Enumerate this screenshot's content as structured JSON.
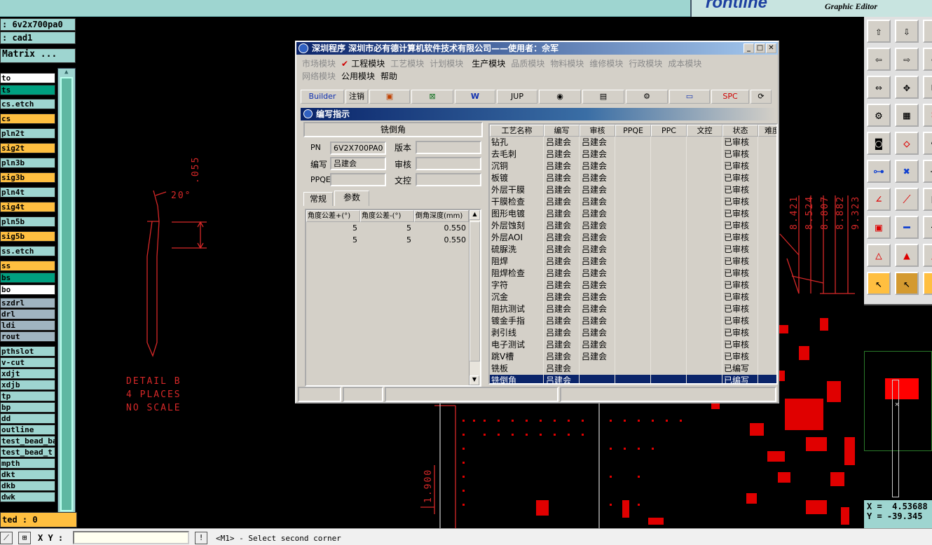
{
  "top": {
    "logo": "rontline",
    "subtitle": "Graphic Editor"
  },
  "info": {
    "job": ": 6v2x700pa0",
    "step": ": cad1",
    "matrix": "Matrix ..."
  },
  "layers": [
    {
      "name": "to",
      "color": "#ffffff"
    },
    {
      "name": "ts",
      "color": "#00a080"
    },
    {
      "name": "cs.etch",
      "color": "#9ed5d0"
    },
    {
      "name": "cs",
      "color": "#ffbf40"
    },
    {
      "name": "pln2t",
      "color": "#9ed5d0"
    },
    {
      "name": "sig2t",
      "color": "#ffbf40"
    },
    {
      "name": "pln3b",
      "color": "#9ed5d0"
    },
    {
      "name": "sig3b",
      "color": "#ffbf40"
    },
    {
      "name": "pln4t",
      "color": "#9ed5d0"
    },
    {
      "name": "sig4t",
      "color": "#ffbf40"
    },
    {
      "name": "pln5b",
      "color": "#9ed5d0"
    },
    {
      "name": "sig5b",
      "color": "#ffbf40"
    },
    {
      "name": "ss.etch",
      "color": "#9ed5d0"
    },
    {
      "name": "ss",
      "color": "#ffbf40"
    },
    {
      "name": "bs",
      "color": "#00a080"
    },
    {
      "name": "bo",
      "color": "#ffffff"
    },
    {
      "name": "szdrl",
      "color": "#a0b4c0"
    },
    {
      "name": "drl",
      "color": "#a0b4c0"
    },
    {
      "name": "ldi",
      "color": "#a0b4c0"
    },
    {
      "name": "rout",
      "color": "#a0b4c0"
    },
    {
      "name": "pthslot",
      "color": "#9ed5d0"
    },
    {
      "name": "v-cut",
      "color": "#9ed5d0"
    },
    {
      "name": "xdjt",
      "color": "#9ed5d0"
    },
    {
      "name": "xdjb",
      "color": "#9ed5d0"
    },
    {
      "name": "tp",
      "color": "#9ed5d0"
    },
    {
      "name": "bp",
      "color": "#9ed5d0"
    },
    {
      "name": "dd",
      "color": "#9ed5d0"
    },
    {
      "name": "outline",
      "color": "#9ed5d0"
    },
    {
      "name": "test_bead_ba",
      "color": "#9ed5d0"
    },
    {
      "name": "test_bead_t",
      "color": "#9ed5d0"
    },
    {
      "name": "mpth",
      "color": "#9ed5d0"
    },
    {
      "name": "dkt",
      "color": "#9ed5d0"
    },
    {
      "name": "dkb",
      "color": "#9ed5d0"
    },
    {
      "name": "dwk",
      "color": "#9ed5d0"
    }
  ],
  "bottom": {
    "selected": "ted : 0",
    "xy_label": "X Y :",
    "xy_value": "",
    "prompt": "<M1> - Select second corner"
  },
  "coords": {
    "x": "X =  4.53688",
    "y": "Y = -39.345"
  },
  "canvas": {
    "angle": "20°",
    "dim_top": ".055",
    "detail": "DETAIL B",
    "places": "4 PLACES",
    "scale": "NO SCALE",
    "dim_bottom": "1.900",
    "right_dims": [
      "8.421",
      "8.524",
      "8.807",
      "8.882",
      "9.323"
    ]
  },
  "dialog": {
    "title": "深圳程序    深圳市必有德计算机软件技术有限公司——使用者：佘军",
    "menu_row1": [
      {
        "label": "市场模块",
        "enabled": false
      },
      {
        "label": "工程模块",
        "enabled": true,
        "checked": true
      },
      {
        "label": "工艺模块",
        "enabled": false
      },
      {
        "label": "计划模块",
        "enabled": false
      },
      {
        "label": "生产模块",
        "enabled": true
      },
      {
        "label": "品质模块",
        "enabled": false
      },
      {
        "label": "物料模块",
        "enabled": false
      },
      {
        "label": "维修模块",
        "enabled": false
      },
      {
        "label": "行政模块",
        "enabled": false
      },
      {
        "label": "成本模块",
        "enabled": false
      }
    ],
    "menu_row2": [
      {
        "label": "网络模块",
        "enabled": false
      },
      {
        "label": "公用模块",
        "enabled": true
      },
      {
        "label": "帮助",
        "enabled": true
      }
    ],
    "toolbar": {
      "builder": "Builder",
      "logout": "注销",
      "jup": "JUP",
      "spc": "SPC"
    },
    "subtitle": "编写指示",
    "form": {
      "heading": "铣倒角",
      "pn_label": "PN",
      "pn_value": "6V2X700PA0",
      "version_label": "版本",
      "version_value": "",
      "author_label": "编写",
      "author_value": "吕建会",
      "review_label": "审核",
      "review_value": "",
      "ppqe_label": "PPQE",
      "ppqe_value": "",
      "doc_label": "文控",
      "doc_value": "",
      "tabs": [
        "常规",
        "参数"
      ]
    },
    "params": {
      "headers": [
        "角度公差+(°)",
        "角度公差-(°)",
        "倒角深度(mm)"
      ],
      "rows": [
        [
          "5",
          "5",
          "0.550"
        ],
        [
          "5",
          "5",
          "0.550"
        ]
      ]
    },
    "process": {
      "headers": [
        "工艺名称",
        "编写",
        "审核",
        "PPQE",
        "PPC",
        "文控",
        "状态",
        "难度"
      ],
      "rows": [
        [
          "钻孔",
          "吕建会",
          "吕建会",
          "已审核"
        ],
        [
          "去毛刺",
          "吕建会",
          "吕建会",
          "已审核"
        ],
        [
          "沉铜",
          "吕建会",
          "吕建会",
          "已审核"
        ],
        [
          "板镀",
          "吕建会",
          "吕建会",
          "已审核"
        ],
        [
          "外层干膜",
          "吕建会",
          "吕建会",
          "已审核"
        ],
        [
          "干膜检查",
          "吕建会",
          "吕建会",
          "已审核"
        ],
        [
          "图形电镀",
          "吕建会",
          "吕建会",
          "已审核"
        ],
        [
          "外层蚀刻",
          "吕建会",
          "吕建会",
          "已审核"
        ],
        [
          "外层AOI",
          "吕建会",
          "吕建会",
          "已审核"
        ],
        [
          "硫脲洗",
          "吕建会",
          "吕建会",
          "已审核"
        ],
        [
          "阻焊",
          "吕建会",
          "吕建会",
          "已审核"
        ],
        [
          "阻焊检查",
          "吕建会",
          "吕建会",
          "已审核"
        ],
        [
          "字符",
          "吕建会",
          "吕建会",
          "已审核"
        ],
        [
          "沉金",
          "吕建会",
          "吕建会",
          "已审核"
        ],
        [
          "阻抗测试",
          "吕建会",
          "吕建会",
          "已审核"
        ],
        [
          "镀金手指",
          "吕建会",
          "吕建会",
          "已审核"
        ],
        [
          "剥引线",
          "吕建会",
          "吕建会",
          "已审核"
        ],
        [
          "电子测试",
          "吕建会",
          "吕建会",
          "已审核"
        ],
        [
          "跳V槽",
          "吕建会",
          "吕建会",
          "已审核"
        ],
        [
          "铣板",
          "吕建会",
          "",
          "已编写"
        ],
        [
          "铣倒角",
          "吕建会",
          "",
          "已编写"
        ]
      ],
      "selected_index": 20
    }
  }
}
